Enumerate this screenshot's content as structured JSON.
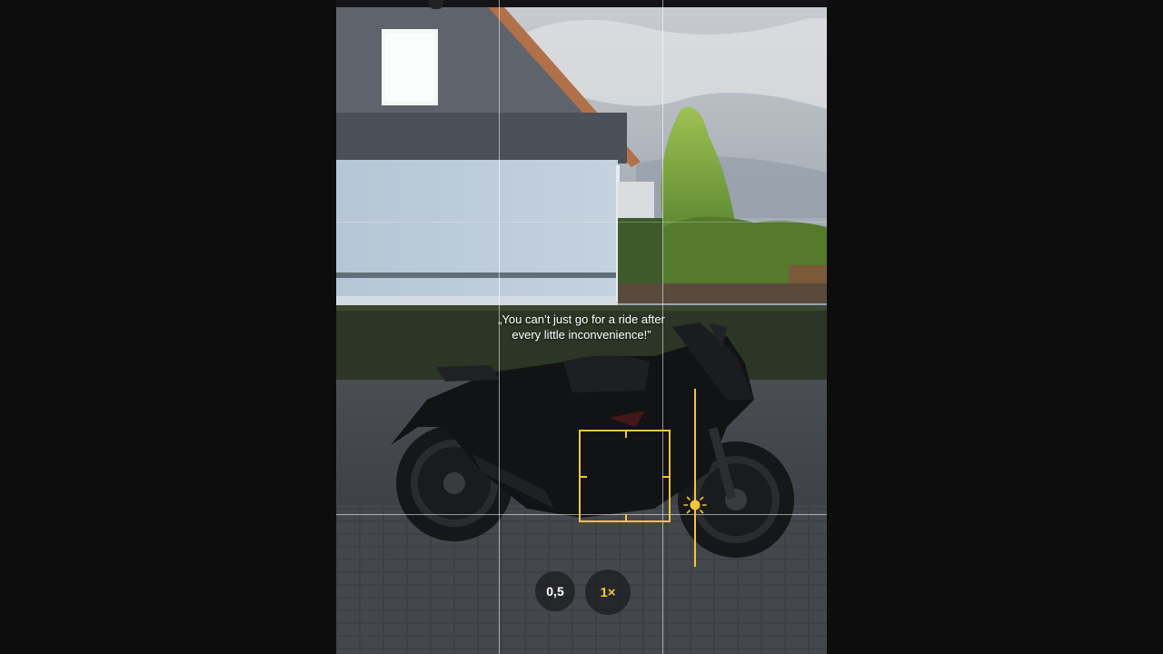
{
  "caption": {
    "line1": "„You can’t just go for a ride after",
    "line2": "every little inconvenience!”"
  },
  "zoom": {
    "ultrawide_label": "0,5",
    "standard_label": "1×",
    "active": "1×"
  },
  "colors": {
    "accent": "#f3c53a",
    "background": "#0d0d0e"
  },
  "icons": {
    "exposure": "sun-icon",
    "focus": "focus-square-icon"
  }
}
